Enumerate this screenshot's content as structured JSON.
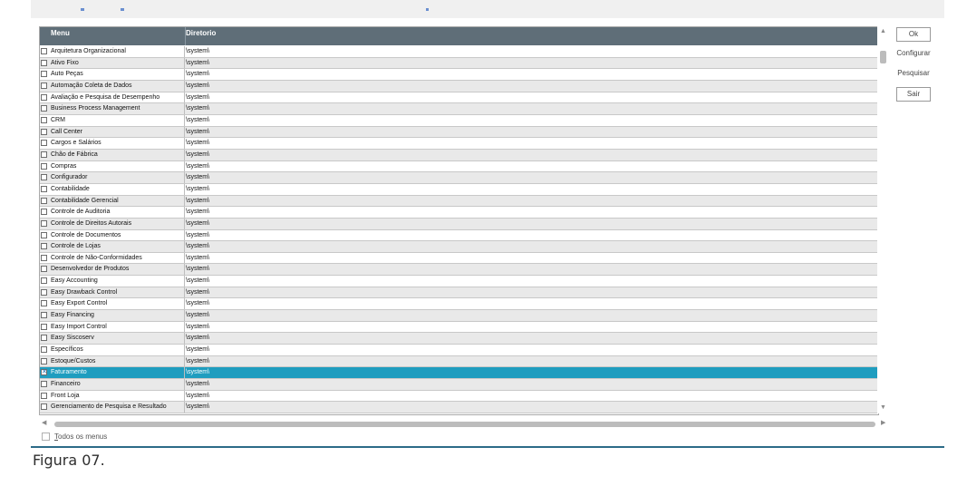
{
  "grid": {
    "columns": [
      "Menu",
      "Diretorio"
    ],
    "rows": [
      {
        "menu": "Arquitetura Organizacional",
        "dir": "\\system\\",
        "checked": false
      },
      {
        "menu": "Ativo Fixo",
        "dir": "\\system\\",
        "checked": false
      },
      {
        "menu": "Auto Peças",
        "dir": "\\system\\",
        "checked": false
      },
      {
        "menu": "Automação Coleta de Dados",
        "dir": "\\system\\",
        "checked": false
      },
      {
        "menu": "Avaliação e Pesquisa de Desempenho",
        "dir": "\\system\\",
        "checked": false
      },
      {
        "menu": "Business Process Management",
        "dir": "\\system\\",
        "checked": false
      },
      {
        "menu": "CRM",
        "dir": "\\system\\",
        "checked": false
      },
      {
        "menu": "Call Center",
        "dir": "\\system\\",
        "checked": false
      },
      {
        "menu": "Cargos e Salários",
        "dir": "\\system\\",
        "checked": false
      },
      {
        "menu": "Chão de Fábrica",
        "dir": "\\system\\",
        "checked": false
      },
      {
        "menu": "Compras",
        "dir": "\\system\\",
        "checked": false
      },
      {
        "menu": "Configurador",
        "dir": "\\system\\",
        "checked": false
      },
      {
        "menu": "Contabilidade",
        "dir": "\\system\\",
        "checked": false
      },
      {
        "menu": "Contabilidade Gerencial",
        "dir": "\\system\\",
        "checked": false
      },
      {
        "menu": "Controle de Auditoria",
        "dir": "\\system\\",
        "checked": false
      },
      {
        "menu": "Controle de Direitos Autorais",
        "dir": "\\system\\",
        "checked": false
      },
      {
        "menu": "Controle de Documentos",
        "dir": "\\system\\",
        "checked": false
      },
      {
        "menu": "Controle de Lojas",
        "dir": "\\system\\",
        "checked": false
      },
      {
        "menu": "Controle de Não-Conformidades",
        "dir": "\\system\\",
        "checked": false
      },
      {
        "menu": "Desenvolvedor de Produtos",
        "dir": "\\system\\",
        "checked": false
      },
      {
        "menu": "Easy Accounting",
        "dir": "\\system\\",
        "checked": false
      },
      {
        "menu": "Easy Drawback Control",
        "dir": "\\system\\",
        "checked": false
      },
      {
        "menu": "Easy Export Control",
        "dir": "\\system\\",
        "checked": false
      },
      {
        "menu": "Easy Financing",
        "dir": "\\system\\",
        "checked": false
      },
      {
        "menu": "Easy Import Control",
        "dir": "\\system\\",
        "checked": false
      },
      {
        "menu": "Easy Siscoserv",
        "dir": "\\system\\",
        "checked": false
      },
      {
        "menu": "Específicos",
        "dir": "\\system\\",
        "checked": false
      },
      {
        "menu": "Estoque/Custos",
        "dir": "\\system\\",
        "checked": false
      },
      {
        "menu": "Faturamento",
        "dir": "\\system\\",
        "checked": true,
        "selected": true
      },
      {
        "menu": "Financeiro",
        "dir": "\\system\\",
        "checked": false
      },
      {
        "menu": "Front Loja",
        "dir": "\\system\\",
        "checked": false
      },
      {
        "menu": "Gerenciamento de Pesquisa e Resultado",
        "dir": "\\system\\",
        "checked": false
      }
    ]
  },
  "buttons": {
    "ok": "Ok",
    "configurar": "Configurar",
    "pesquisar": "Pesquisar",
    "sair": "Sair"
  },
  "all_menus": {
    "underlined": "T",
    "rest": "odos os menus",
    "checked": false
  },
  "caption": "Figura 07.",
  "colors": {
    "header_bg": "#5f6e78",
    "selected_row": "#1f9dbf",
    "odd_row": "#e9e9e9",
    "bottom_line": "#2c6b88"
  },
  "icons": {
    "scroll_up": "▲",
    "scroll_down": "▼",
    "scroll_left": "◀",
    "scroll_right": "▶",
    "check": "✕"
  }
}
